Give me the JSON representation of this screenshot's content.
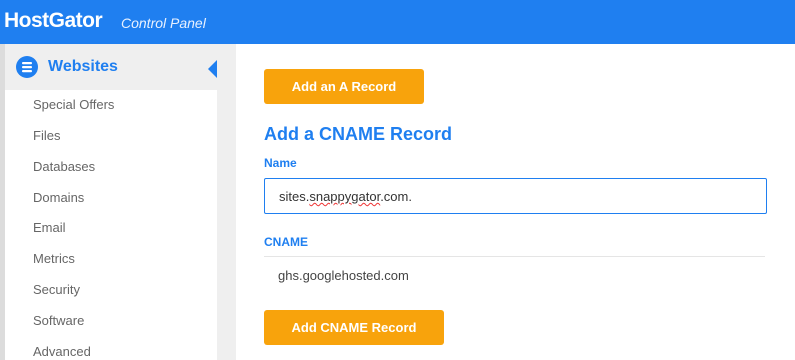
{
  "app": {
    "brand": "HostGator",
    "subtitle": "Control Panel"
  },
  "sidebar": {
    "section_title": "Websites",
    "items": [
      {
        "label": "Special Offers"
      },
      {
        "label": "Files"
      },
      {
        "label": "Databases"
      },
      {
        "label": "Domains"
      },
      {
        "label": "Email"
      },
      {
        "label": "Metrics"
      },
      {
        "label": "Security"
      },
      {
        "label": "Software"
      },
      {
        "label": "Advanced"
      }
    ]
  },
  "main": {
    "add_a_record_button": "Add an A Record",
    "form_title": "Add a CNAME Record",
    "name_label": "Name",
    "name_value_prefix": "sites.",
    "name_value_misspelled": "snappygator",
    "name_value_suffix": ".com.",
    "cname_label": "CNAME",
    "cname_value": "ghs.googlehosted.com",
    "add_cname_button": "Add CNAME Record"
  },
  "icons": {
    "section": "websites-icon",
    "collapse": "collapse-arrow-icon"
  },
  "colors": {
    "brand_blue": "#1f7ff0",
    "button_orange": "#f8a30c"
  }
}
